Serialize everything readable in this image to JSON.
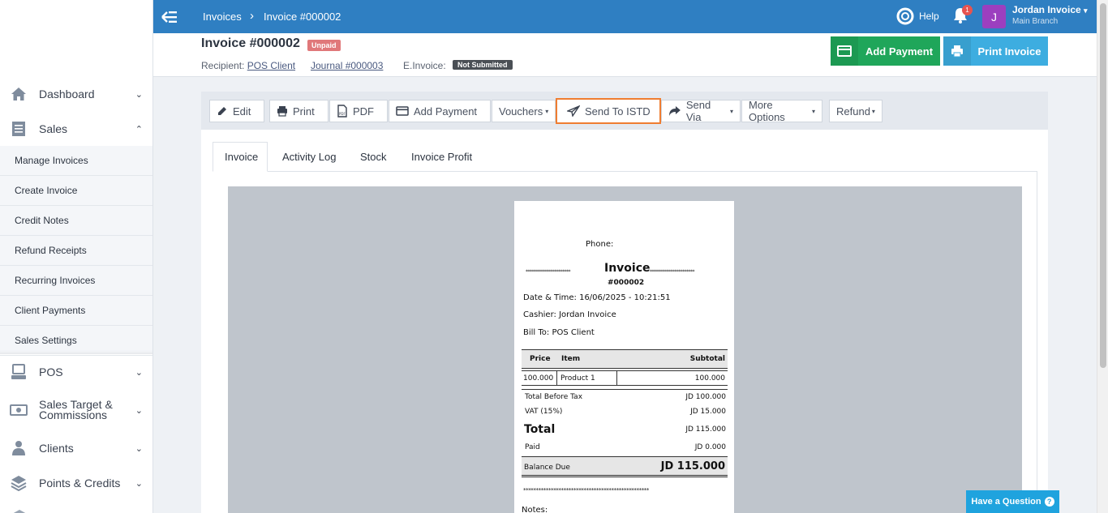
{
  "sidebar": {
    "items": [
      {
        "label": "Dashboard",
        "icon": "home-icon"
      },
      {
        "label": "Sales",
        "icon": "sales-icon"
      },
      {
        "label": "POS",
        "icon": "pos-icon"
      },
      {
        "label": "Sales Target & Commissions",
        "icon": "commission-icon"
      },
      {
        "label": "Clients",
        "icon": "clients-icon"
      },
      {
        "label": "Points & Credits",
        "icon": "layers-icon"
      }
    ],
    "sales_submenu": [
      "Manage Invoices",
      "Create Invoice",
      "Credit Notes",
      "Refund Receipts",
      "Recurring Invoices",
      "Client Payments",
      "Sales Settings"
    ]
  },
  "topbar": {
    "breadcrumb_1": "Invoices",
    "breadcrumb_sep": "›",
    "breadcrumb_2": "Invoice #000002",
    "help_label": "Help",
    "notification_count": "1",
    "avatar_letter": "J",
    "user_name": "Jordan Invoice",
    "user_branch": "Main Branch",
    "accent": "#2f7fc2"
  },
  "header": {
    "title": "Invoice #000002",
    "status": "Unpaid",
    "recipient_label": "Recipient:",
    "recipient_value": "POS Client",
    "journal_link": "Journal #000003",
    "einvoice_label": "E.Invoice:",
    "einvoice_status": "Not Submitted",
    "add_payment_label": "Add Payment",
    "print_invoice_label": "Print Invoice"
  },
  "toolbar": {
    "edit": "Edit",
    "print": "Print",
    "pdf": "PDF",
    "add_payment": "Add Payment",
    "vouchers": "Vouchers",
    "send_istd": "Send To ISTD",
    "send_via": "Send Via",
    "more_options": "More Options",
    "refund": "Refund"
  },
  "tabs": {
    "invoice": "Invoice",
    "activity_log": "Activity Log",
    "stock": "Stock",
    "invoice_profit": "Invoice Profit"
  },
  "receipt": {
    "phone_label": "Phone:",
    "stars_left": "**********************",
    "heading": "Invoice",
    "stars_right": "**********************",
    "number": "#000002",
    "datetime": "Date & Time: 16/06/2025 - 10:21:51",
    "cashier": "Cashier: Jordan Invoice",
    "bill_to": "Bill To: POS Client",
    "col_price": "Price",
    "col_item": "Item",
    "col_subtotal": "Subtotal",
    "row_price": "100.000",
    "row_item": "Product 1",
    "row_subtotal": "100.000",
    "total_before_tax_label": "Total Before Tax",
    "total_before_tax_value": "JD 100.000‎",
    "vat_label": "VAT (15%)",
    "vat_value": "JD 15.000‎",
    "total_label": "Total",
    "total_value": "JD 115.000‎",
    "paid_label": "Paid",
    "paid_value": "JD 0.000‎",
    "balance_label": "Balance Due",
    "balance_value": "JD 115.000‎",
    "stars_line": "**************************************************",
    "notes_label": "Notes:"
  },
  "help_widget": {
    "label": "Have a Question"
  }
}
